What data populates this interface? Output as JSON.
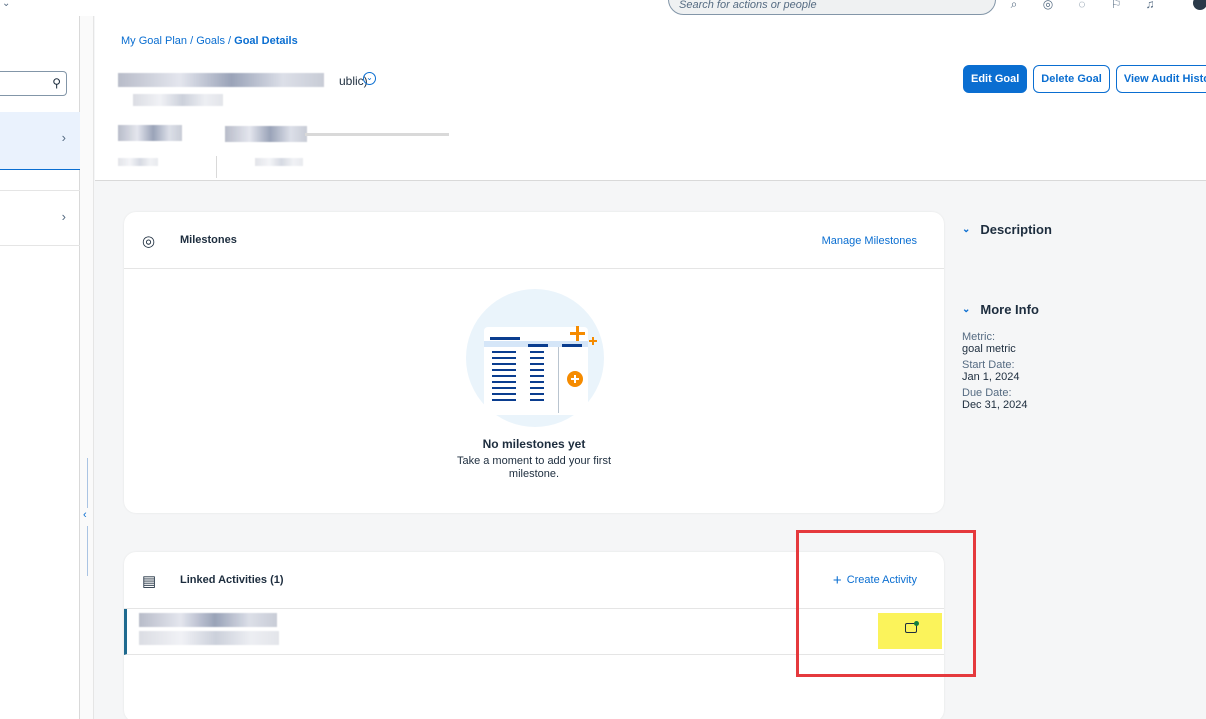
{
  "global_search": {
    "placeholder": "Search for actions or people"
  },
  "breadcrumb": {
    "parts": [
      "My Goal Plan",
      "Goals"
    ],
    "separator": "/",
    "current": "Goal Details"
  },
  "goal": {
    "title_suffix": "ublic)"
  },
  "header_actions": {
    "edit": "Edit Goal",
    "delete": "Delete Goal",
    "audit": "View Audit Histo"
  },
  "milestones": {
    "title": "Milestones",
    "manage": "Manage Milestones",
    "empty_title": "No milestones yet",
    "empty_sub": "Take a moment to add your first milestone."
  },
  "linked": {
    "title": "Linked Activities (1)",
    "create": "Create Activity"
  },
  "side": {
    "description_title": "Description",
    "more_info_title": "More Info",
    "fields": [
      {
        "label": "Metric:",
        "value": "goal metric"
      },
      {
        "label": "Start Date:",
        "value": "Jan 1, 2024"
      },
      {
        "label": "Due Date:",
        "value": "Dec 31, 2024"
      }
    ]
  },
  "colors": {
    "accent": "#0a6ed1",
    "highlight": "#fbf35b",
    "annotation": "#e5393d"
  }
}
